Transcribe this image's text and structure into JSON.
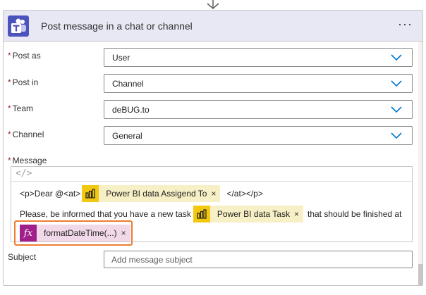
{
  "header": {
    "title": "Post message in a chat or channel",
    "more_label": "···",
    "brand_color": "#4b53bc"
  },
  "fields": {
    "post_as": {
      "label": "Post as",
      "value": "User"
    },
    "post_in": {
      "label": "Post in",
      "value": "Channel"
    },
    "team": {
      "label": "Team",
      "value": "deBUG.to"
    },
    "channel": {
      "label": "Channel",
      "value": "General"
    },
    "message": {
      "label": "Message"
    },
    "subject": {
      "label": "Subject",
      "placeholder": "Add message subject",
      "value": ""
    }
  },
  "required_mark": "*",
  "message": {
    "code_view_icon": "</>",
    "line1_prefix": "<p>Dear @<at>",
    "line1_token": "Power BI data Assigend To",
    "line1_suffix": "</at></p>",
    "line2_prefix": "Please, be informed that you have a new task",
    "line2_token": "Power BI data Task",
    "line2_suffix": "that should be finished at",
    "line3_token": "formatDateTime(...)",
    "fx_glyph": "fx",
    "remove_glyph": "×"
  },
  "icons": {
    "arrow": "arrow-down-icon",
    "teams": "teams-logo-icon",
    "chevron": "chevron-down-icon",
    "powerbi": "power-bi-icon",
    "function": "function-icon",
    "close": "close-icon"
  },
  "colors": {
    "header_bg": "#e8e8f4",
    "chevron": "#0078d4",
    "powerbi_token_bg": "#f7efc6",
    "powerbi_icon_bg": "#f2c811",
    "fx_token_bg": "#f1d9ea",
    "fx_icon_bg": "#a01f8a",
    "highlight": "#ed7d31",
    "required": "#a4262c"
  }
}
